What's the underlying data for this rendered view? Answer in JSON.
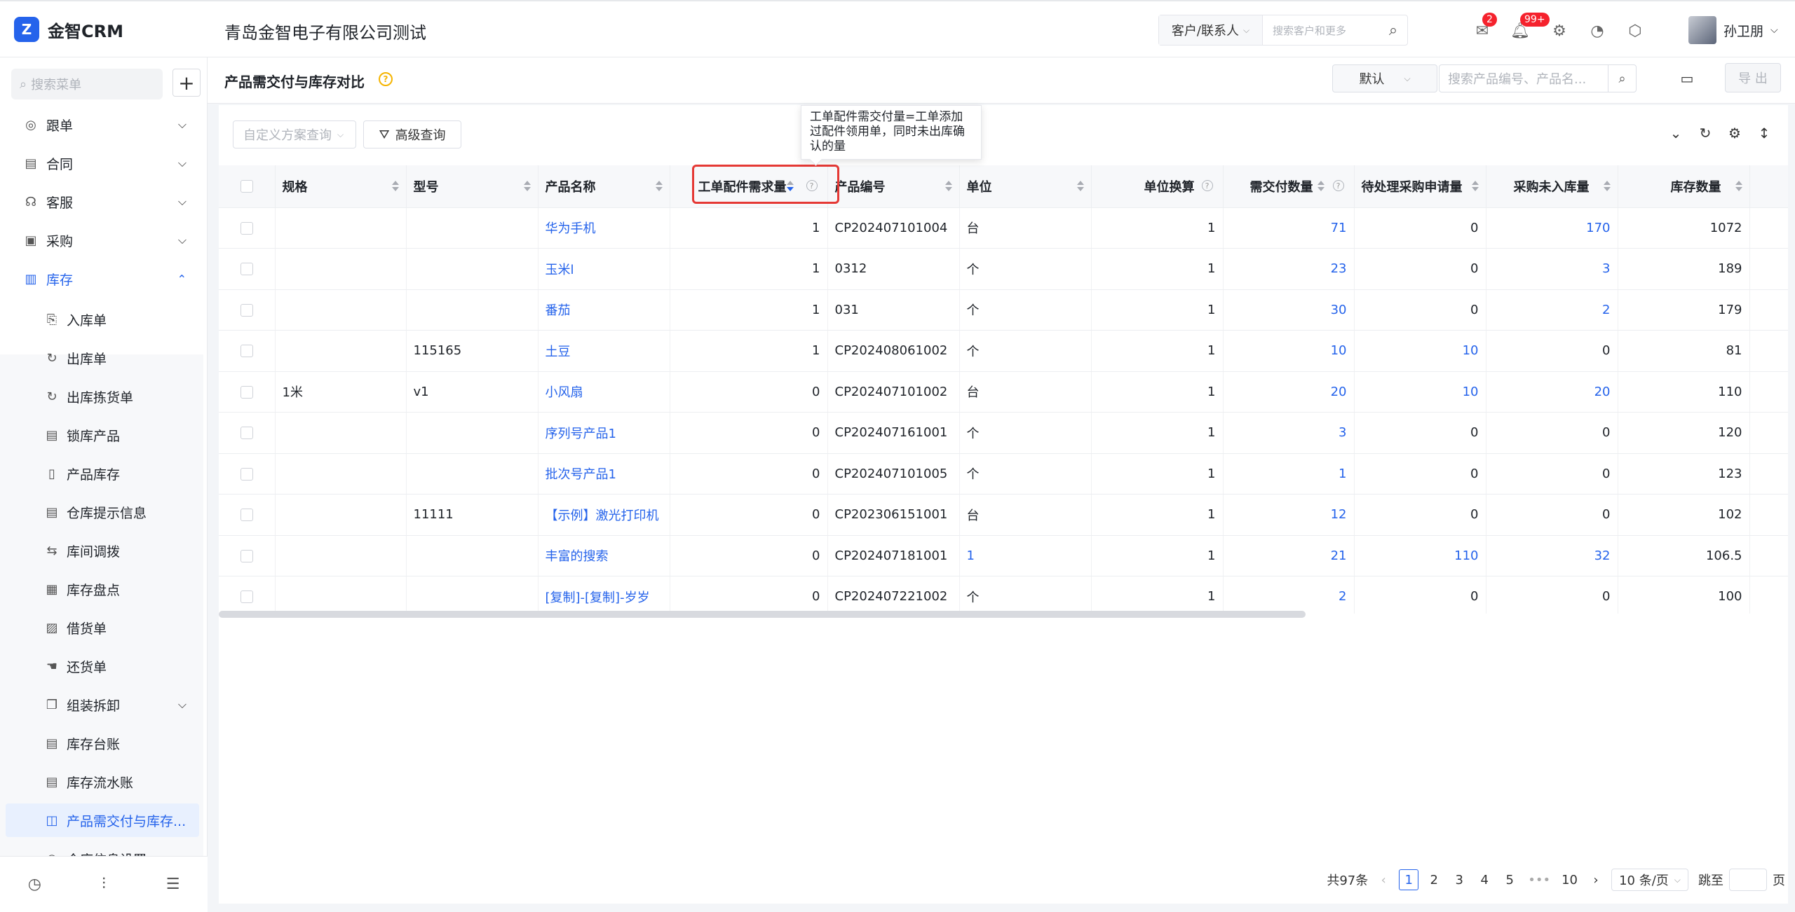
{
  "app": {
    "logo_text": "金智CRM",
    "company": "青岛金智电子有限公司测试"
  },
  "topbar": {
    "search_type": "客户/联系人",
    "search_placeholder": "搜索客户和更多",
    "message_badge": "2",
    "notification_badge": "99+",
    "user_name": "孙卫朋"
  },
  "sidebar": {
    "search_placeholder": "搜索菜单",
    "items": [
      {
        "label": "跟单",
        "icon": "target-icon",
        "expandable": true
      },
      {
        "label": "合同",
        "icon": "contract-icon",
        "expandable": true
      },
      {
        "label": "客服",
        "icon": "service-icon",
        "expandable": true
      },
      {
        "label": "采购",
        "icon": "purchase-icon",
        "expandable": true
      },
      {
        "label": "库存",
        "icon": "warehouse-icon",
        "expandable": true,
        "open": true
      }
    ],
    "sub_items": [
      {
        "label": "入库单",
        "icon": "inbound-icon"
      },
      {
        "label": "出库单",
        "icon": "outbound-icon"
      },
      {
        "label": "出库拣货单",
        "icon": "picking-icon"
      },
      {
        "label": "锁库产品",
        "icon": "lock-doc-icon"
      },
      {
        "label": "产品库存",
        "icon": "stock-doc-icon"
      },
      {
        "label": "仓库提示信息",
        "icon": "info-doc-icon"
      },
      {
        "label": "库间调拨",
        "icon": "transfer-icon"
      },
      {
        "label": "库存盘点",
        "icon": "calculator-icon"
      },
      {
        "label": "借货单",
        "icon": "borrow-icon"
      },
      {
        "label": "还货单",
        "icon": "return-icon"
      },
      {
        "label": "组装拆卸",
        "icon": "assembly-icon",
        "expandable": true
      },
      {
        "label": "库存台账",
        "icon": "ledger-icon"
      },
      {
        "label": "库存流水账",
        "icon": "journal-icon"
      },
      {
        "label": "产品需交付与库存...",
        "icon": "compare-icon",
        "active": true
      },
      {
        "label": "仓库信息设置",
        "icon": "settings-doc-icon"
      }
    ]
  },
  "page": {
    "title": "产品需交付与库存对比",
    "view_select": "默认",
    "search_placeholder": "搜索产品编号、产品名...",
    "export_label": "导 出",
    "scheme_placeholder": "自定义方案查询",
    "advanced_query": "高级查询",
    "tooltip": "工单配件需交付量=工单添加过配件领用单，同时未出库确认的量"
  },
  "table": {
    "columns": [
      "规格",
      "型号",
      "产品名称",
      "工单配件需求量",
      "产品编号",
      "单位",
      "单位换算",
      "需交付数量",
      "待处理采购申请量",
      "采购未入库量",
      "库存数量"
    ],
    "rows": [
      {
        "spec": "",
        "model": "",
        "name": "华为手机",
        "demand": "1",
        "code": "CP202407101004",
        "unit": "台",
        "conv": "1",
        "deliver": "71",
        "pending": "0",
        "unstock": "170",
        "stock": "1072"
      },
      {
        "spec": "",
        "model": "",
        "name": "玉米l",
        "demand": "1",
        "code": "0312",
        "unit": "个",
        "conv": "1",
        "deliver": "23",
        "pending": "0",
        "unstock": "3",
        "stock": "189"
      },
      {
        "spec": "",
        "model": "",
        "name": "番茄",
        "demand": "1",
        "code": "031",
        "unit": "个",
        "conv": "1",
        "deliver": "30",
        "pending": "0",
        "unstock": "2",
        "stock": "179"
      },
      {
        "spec": "",
        "model": "115165",
        "name": "土豆",
        "demand": "1",
        "code": "CP202408061002",
        "unit": "个",
        "conv": "1",
        "deliver": "10",
        "pending": "10",
        "unstock": "0",
        "stock": "81"
      },
      {
        "spec": "1米",
        "model": "v1",
        "name": "小风扇",
        "demand": "0",
        "code": "CP202407101002",
        "unit": "台",
        "conv": "1",
        "deliver": "20",
        "pending": "10",
        "unstock": "20",
        "stock": "110"
      },
      {
        "spec": "",
        "model": "",
        "name": "序列号产品1",
        "demand": "0",
        "code": "CP202407161001",
        "unit": "个",
        "conv": "1",
        "deliver": "3",
        "pending": "0",
        "unstock": "0",
        "stock": "120"
      },
      {
        "spec": "",
        "model": "",
        "name": "批次号产品1",
        "demand": "0",
        "code": "CP202407101005",
        "unit": "个",
        "conv": "1",
        "deliver": "1",
        "pending": "0",
        "unstock": "0",
        "stock": "123"
      },
      {
        "spec": "",
        "model": "11111",
        "name": "【示例】激光打印机",
        "demand": "0",
        "code": "CP202306151001",
        "unit": "台",
        "conv": "1",
        "deliver": "12",
        "pending": "0",
        "unstock": "0",
        "stock": "102"
      },
      {
        "spec": "",
        "model": "",
        "name": "丰富的搜索",
        "demand": "0",
        "code": "CP202407181001",
        "unit": "1",
        "conv": "1",
        "deliver": "21",
        "pending": "110",
        "unstock": "32",
        "stock": "106.5"
      },
      {
        "spec": "",
        "model": "",
        "name": "[复制]-[复制]-岁岁",
        "demand": "0",
        "code": "CP202407221002",
        "unit": "个",
        "conv": "1",
        "deliver": "2",
        "pending": "0",
        "unstock": "0",
        "stock": "100"
      }
    ]
  },
  "pagination": {
    "total": "共97条",
    "pages": [
      "1",
      "2",
      "3",
      "4",
      "5"
    ],
    "ellipsis": "•••",
    "last": "10",
    "page_size": "10 条/页",
    "jump_label": "跳至",
    "page_suffix": "页"
  },
  "colors": {
    "accent": "#2563eb",
    "badge": "#f5222d",
    "highlight": "#e53935"
  }
}
